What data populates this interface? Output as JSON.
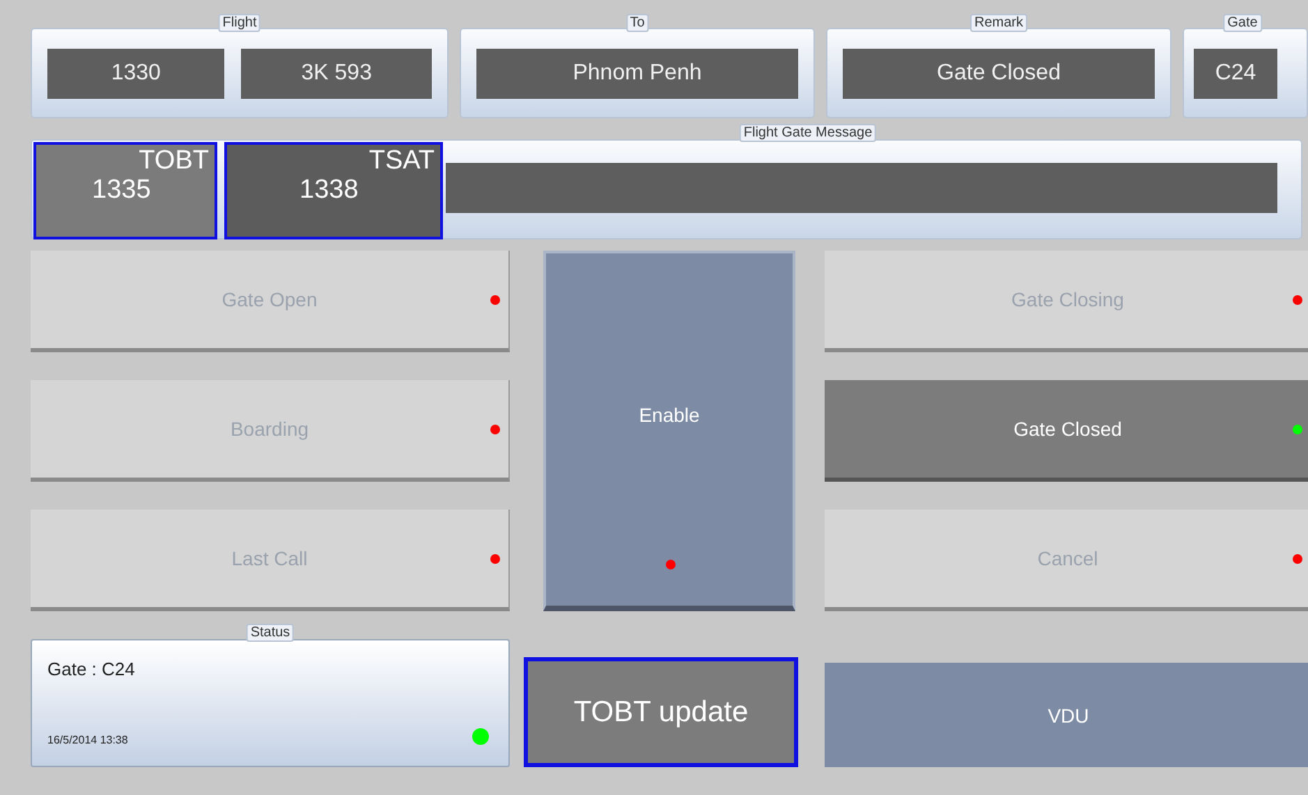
{
  "flight_info": {
    "flight": {
      "label": "Flight",
      "time": "1330",
      "number": "3K 593"
    },
    "to": {
      "label": "To",
      "value": "Phnom Penh"
    },
    "remark": {
      "label": "Remark",
      "value": "Gate Closed"
    },
    "gate": {
      "label": "Gate",
      "value": "C24"
    }
  },
  "message": {
    "label": "Flight Gate Message",
    "tobt": {
      "label": "TOBT",
      "value": "1335"
    },
    "tsat": {
      "label": "TSAT",
      "value": "1338"
    }
  },
  "left_buttons": [
    {
      "label": "Gate Open",
      "selected": false,
      "color": "#ff0000"
    },
    {
      "label": "Boarding",
      "selected": false,
      "color": "#ff0000"
    },
    {
      "label": "Last Call",
      "selected": false,
      "color": "#ff0000"
    }
  ],
  "enable_button": {
    "label": "Enable",
    "color": "#ff0000"
  },
  "right_buttons": [
    {
      "label": "Gate Closing",
      "selected": false,
      "color": "#ff0000"
    },
    {
      "label": "Gate Closed",
      "selected": true,
      "color": "#00ff00"
    },
    {
      "label": "Cancel",
      "selected": false,
      "color": "#ff0000"
    }
  ],
  "status": {
    "label": "Status",
    "gate": "Gate : C24",
    "timestamp": "16/5/2014 13:38",
    "color": "#00ff00"
  },
  "tobt_update_button": {
    "label": "TOBT update"
  },
  "vdu_button": {
    "label": "VDU"
  }
}
